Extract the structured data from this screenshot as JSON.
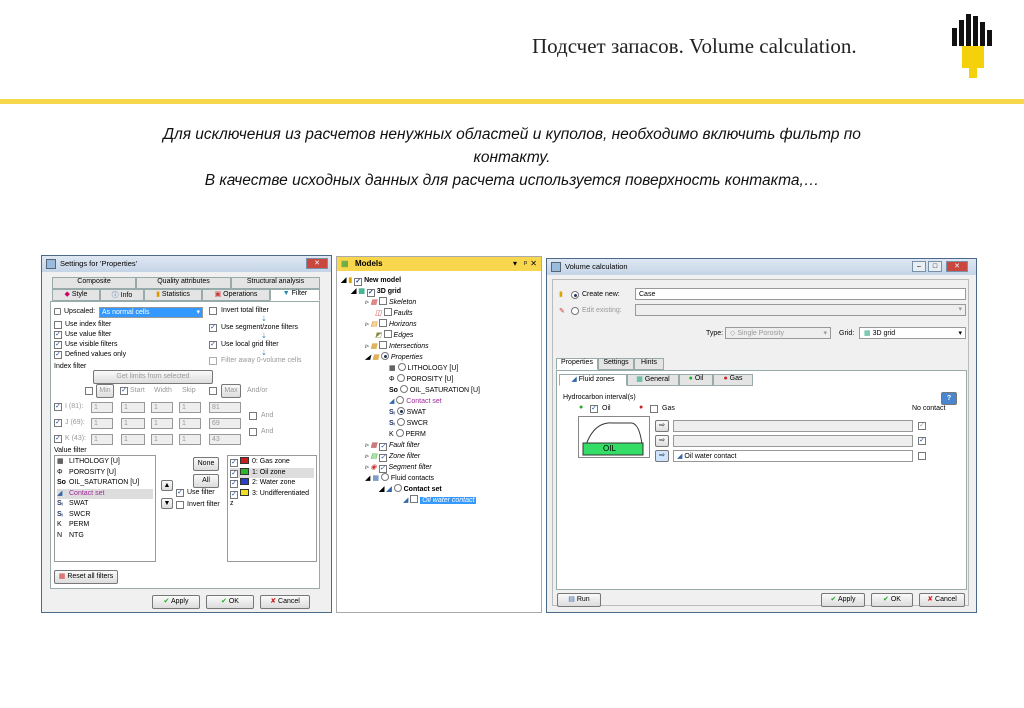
{
  "slide": {
    "title": "Подсчет запасов. Volume calculation.",
    "text": [
      "Для исключения из расчетов ненужных областей и куполов, необходимо включить фильтр по",
      "контакту.",
      "В качестве исходных данных для расчета используется поверхность контакта,…"
    ]
  },
  "settings": {
    "title": "Settings for 'Properties'",
    "tabs_top": [
      "Composite",
      "Quality attributes",
      "Structural analysis"
    ],
    "tabs_bottom": [
      "Style",
      "Info",
      "Statistics",
      "Operations",
      "Filter"
    ],
    "upscaled_label": "Upscaled:",
    "upscaled_value": "As normal cells",
    "checks_left": [
      "Use index filter",
      "Use value filter",
      "Use visible filters",
      "Defined values only"
    ],
    "checks_right": [
      "Invert total filter",
      "Use segment/zone filters",
      "Use local grid filter",
      "Filter away 0-volume cells"
    ],
    "index_filter": "Index filter",
    "get_limits": "Get limits from selected",
    "col_min": "Min",
    "col_start": "Start",
    "col_width": "Width",
    "col_skip": "Skip",
    "col_max": "Max",
    "col_andor": "And/or",
    "rows": [
      {
        "label": "I (81):",
        "v1": "1",
        "v2": "1",
        "v3": "1",
        "v4": "1",
        "max": "81",
        "op": ""
      },
      {
        "label": "J (69):",
        "v1": "1",
        "v2": "1",
        "v3": "1",
        "v4": "1",
        "max": "69",
        "op": "And"
      },
      {
        "label": "K (43):",
        "v1": "1",
        "v2": "1",
        "v3": "1",
        "v4": "1",
        "max": "43",
        "op": "And"
      }
    ],
    "value_filter": "Value filter",
    "props": [
      "LITHOLOGY [U]",
      "POROSITY [U]",
      "OIL_SATURATION [U]",
      "Contact set",
      "SWAT",
      "SWCR",
      "PERM",
      "NTG"
    ],
    "none": "None",
    "all": "All",
    "use_filter": "Use filter",
    "invert_filter": "Invert filter",
    "zones": [
      "0: Gas zone",
      "1: Oil zone",
      "2: Water zone",
      "3: Undifferentiated z"
    ],
    "zone_colors": [
      "#c81e1e",
      "#2db42d",
      "#2b3fc8",
      "#f0e020"
    ],
    "reset": "Reset all filters",
    "apply": "Apply",
    "ok": "OK",
    "cancel": "Cancel"
  },
  "models": {
    "title": "Models",
    "header_btns": [
      "▾",
      "ᵖ",
      "✕"
    ],
    "items": [
      "New model",
      "3D grid",
      "Skeleton",
      "Faults",
      "Horizons",
      "Edges",
      "Intersections",
      "Properties",
      "LITHOLOGY [U]",
      "POROSITY [U]",
      "OIL_SATURATION [U]",
      "Contact set",
      "SWAT",
      "SWCR",
      "PERM",
      "Fault filter",
      "Zone filter",
      "Segment filter",
      "Fluid contacts",
      "Contact set",
      "Oil water contact"
    ]
  },
  "volume": {
    "title": "Volume calculation",
    "create_new": "Create new:",
    "create_value": "Case",
    "edit_existing": "Edit existing:",
    "type_label": "Type:",
    "type_value": "Single Porosity",
    "grid_label": "Grid:",
    "grid_value": "3D grid",
    "tabs": [
      "Properties",
      "Settings",
      "Hints"
    ],
    "subtabs": [
      "Fluid zones",
      "General",
      "Oil",
      "Gas"
    ],
    "hc_label": "Hydrocarbon interval(s)",
    "oil": "Oil",
    "gas": "Gas",
    "no_contact": "No contact",
    "oil_label": "OIL",
    "contact_row": "Oil water contact",
    "run": "Run",
    "apply": "Apply",
    "ok": "OK",
    "cancel": "Cancel",
    "help": "?"
  }
}
